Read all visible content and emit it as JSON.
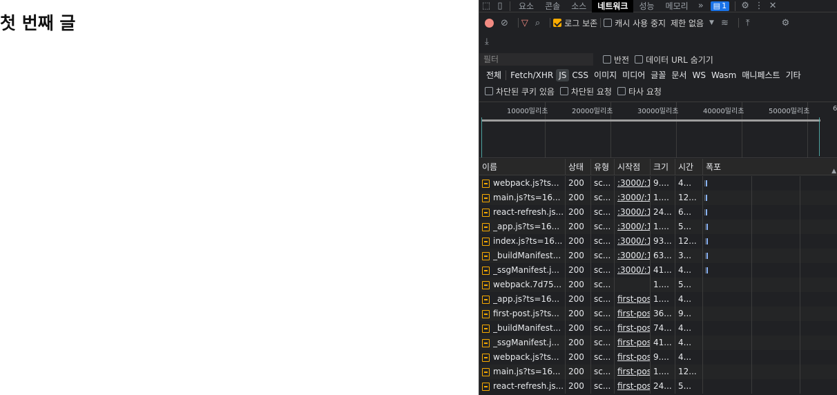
{
  "page": {
    "title": "첫 번째 글"
  },
  "devtools": {
    "tabs": [
      "요소",
      "콘솔",
      "소스",
      "네트워크",
      "성능",
      "메모리"
    ],
    "active_tab": "네트워크",
    "issues_badge": "1",
    "toolbar": {
      "preserve_log": "로그 보존",
      "disable_cache": "캐시 사용 중지",
      "throttling": "제한 없음"
    },
    "filter": {
      "placeholder": "필터",
      "invert": "반전",
      "hide_data_urls": "데이터 URL 숨기기"
    },
    "types": [
      "전체",
      "Fetch/XHR",
      "JS",
      "CSS",
      "이미지",
      "미디어",
      "글꼴",
      "문서",
      "WS",
      "Wasm",
      "매니페스트",
      "기타"
    ],
    "selected_type": "JS",
    "blocked": {
      "blocked_cookies": "차단된 쿠키 있음",
      "blocked_requests": "차단된 요청",
      "third_party": "타사 요청"
    },
    "overview_ticks": [
      "10000밀리초",
      "20000밀리초",
      "30000밀리초",
      "40000밀리초",
      "50000밀리초",
      "6"
    ],
    "columns": {
      "name": "이름",
      "status": "상태",
      "type": "유형",
      "initiator": "시작점",
      "size": "크기",
      "time": "시간",
      "waterfall": "폭포"
    },
    "requests": [
      {
        "name": "webpack.js?ts...",
        "status": "200",
        "type": "sc...",
        "initiator": ":3000/:1",
        "size": "9....",
        "time": "4...",
        "bar": "blue"
      },
      {
        "name": "main.js?ts=16...",
        "status": "200",
        "type": "sc...",
        "initiator": ":3000/:1",
        "size": "1....",
        "time": "12...",
        "bar": "blue"
      },
      {
        "name": "react-refresh.js...",
        "status": "200",
        "type": "sc...",
        "initiator": ":3000/:1",
        "size": "24...",
        "time": "6...",
        "bar": "blue"
      },
      {
        "name": "_app.js?ts=16...",
        "status": "200",
        "type": "sc...",
        "initiator": ":3000/:1",
        "size": "1....",
        "time": "5...",
        "bar": "blue"
      },
      {
        "name": "index.js?ts=16...",
        "status": "200",
        "type": "sc...",
        "initiator": ":3000/:1",
        "size": "93...",
        "time": "12...",
        "bar": "blue"
      },
      {
        "name": "_buildManifest...",
        "status": "200",
        "type": "sc...",
        "initiator": ":3000/:1",
        "size": "63...",
        "time": "3...",
        "bar": "blue"
      },
      {
        "name": "_ssgManifest.j...",
        "status": "200",
        "type": "sc...",
        "initiator": ":3000/:1",
        "size": "41...",
        "time": "4...",
        "bar": "blue"
      },
      {
        "name": "webpack.7d75...",
        "status": "200",
        "type": "sc...",
        "initiator": "",
        "size": "1....",
        "time": "5...",
        "bar": ""
      },
      {
        "name": "_app.js?ts=16...",
        "status": "200",
        "type": "sc...",
        "initiator": "first-post",
        "size": "1....",
        "time": "4...",
        "bar": ""
      },
      {
        "name": "first-post.js?ts...",
        "status": "200",
        "type": "sc...",
        "initiator": "first-post",
        "size": "36...",
        "time": "9...",
        "bar": ""
      },
      {
        "name": "_buildManifest...",
        "status": "200",
        "type": "sc...",
        "initiator": "first-post",
        "size": "74...",
        "time": "4...",
        "bar": ""
      },
      {
        "name": "_ssgManifest.j...",
        "status": "200",
        "type": "sc...",
        "initiator": "first-post",
        "size": "41...",
        "time": "4...",
        "bar": ""
      },
      {
        "name": "webpack.js?ts...",
        "status": "200",
        "type": "sc...",
        "initiator": "first-post",
        "size": "9....",
        "time": "4...",
        "bar": ""
      },
      {
        "name": "main.js?ts=16...",
        "status": "200",
        "type": "sc...",
        "initiator": "first-post",
        "size": "1....",
        "time": "12...",
        "bar": ""
      },
      {
        "name": "react-refresh.js...",
        "status": "200",
        "type": "sc...",
        "initiator": "first-post",
        "size": "24...",
        "time": "5...",
        "bar": ""
      }
    ]
  }
}
